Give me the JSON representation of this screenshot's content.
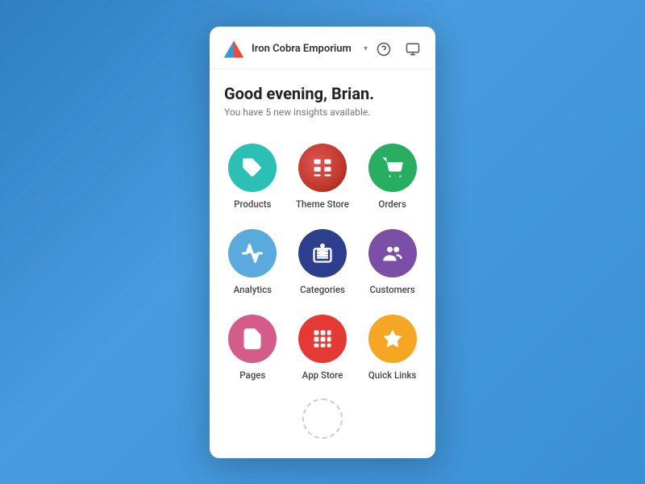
{
  "background": {
    "color": "#3b8fd4"
  },
  "header": {
    "store_name": "Iron Cobra Emporium",
    "dropdown_arrow": "▾",
    "help_icon": "?",
    "display_icon": "🖥"
  },
  "greeting": {
    "title": "Good evening, Brian.",
    "subtitle": "You have 5 new insights available."
  },
  "grid_items": [
    {
      "id": "products",
      "label": "Products",
      "color_class": "bg-teal",
      "icon": "tag"
    },
    {
      "id": "theme-store",
      "label": "Theme Store",
      "color_class": "bg-red-dot",
      "icon": "grid"
    },
    {
      "id": "orders",
      "label": "Orders",
      "color_class": "bg-green",
      "icon": "cart"
    },
    {
      "id": "analytics",
      "label": "Analytics",
      "color_class": "bg-blue-light",
      "icon": "pulse"
    },
    {
      "id": "categories",
      "label": "Categories",
      "color_class": "bg-dark-blue",
      "icon": "list"
    },
    {
      "id": "customers",
      "label": "Customers",
      "color_class": "bg-purple",
      "icon": "people"
    },
    {
      "id": "pages",
      "label": "Pages",
      "color_class": "bg-pink",
      "icon": "page"
    },
    {
      "id": "app-store",
      "label": "App Store",
      "color_class": "bg-red",
      "icon": "apps"
    },
    {
      "id": "quick-links",
      "label": "Quick Links",
      "color_class": "bg-orange",
      "icon": "star"
    }
  ]
}
